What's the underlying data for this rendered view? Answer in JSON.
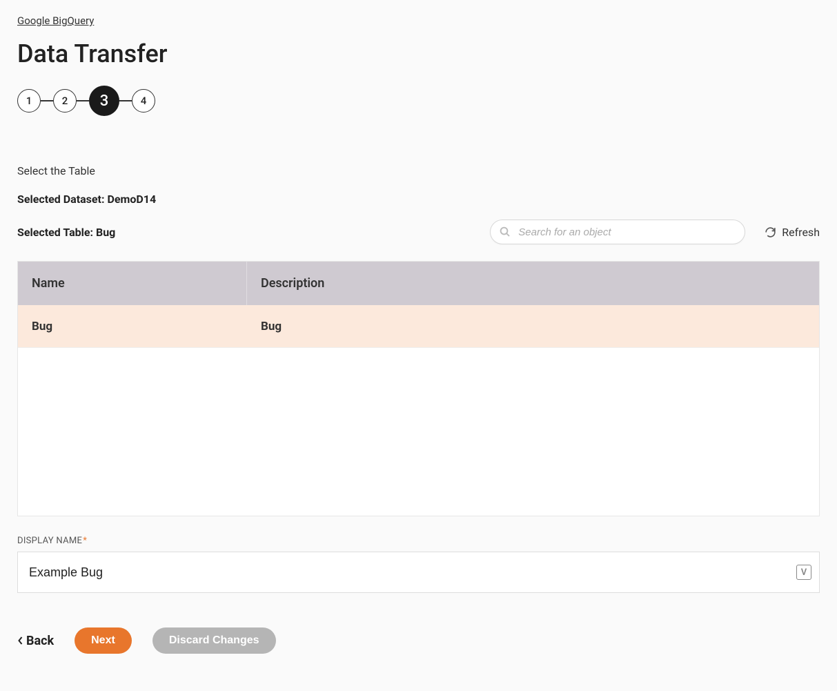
{
  "breadcrumb": "Google BigQuery",
  "page_title": "Data Transfer",
  "stepper": {
    "steps": [
      "1",
      "2",
      "3",
      "4"
    ],
    "active_index": 2
  },
  "section_label": "Select the Table",
  "selected_dataset_label": "Selected Dataset: DemoD14",
  "selected_table_label": "Selected Table: Bug",
  "search": {
    "placeholder": "Search for an object"
  },
  "refresh_label": "Refresh",
  "table": {
    "headers": {
      "name": "Name",
      "description": "Description"
    },
    "rows": [
      {
        "name": "Bug",
        "description": "Bug",
        "selected": true
      }
    ]
  },
  "display_name": {
    "label": "DISPLAY NAME",
    "required_marker": "*",
    "value": "Example Bug",
    "suffix_glyph": "V"
  },
  "actions": {
    "back": "Back",
    "next": "Next",
    "discard": "Discard Changes"
  }
}
